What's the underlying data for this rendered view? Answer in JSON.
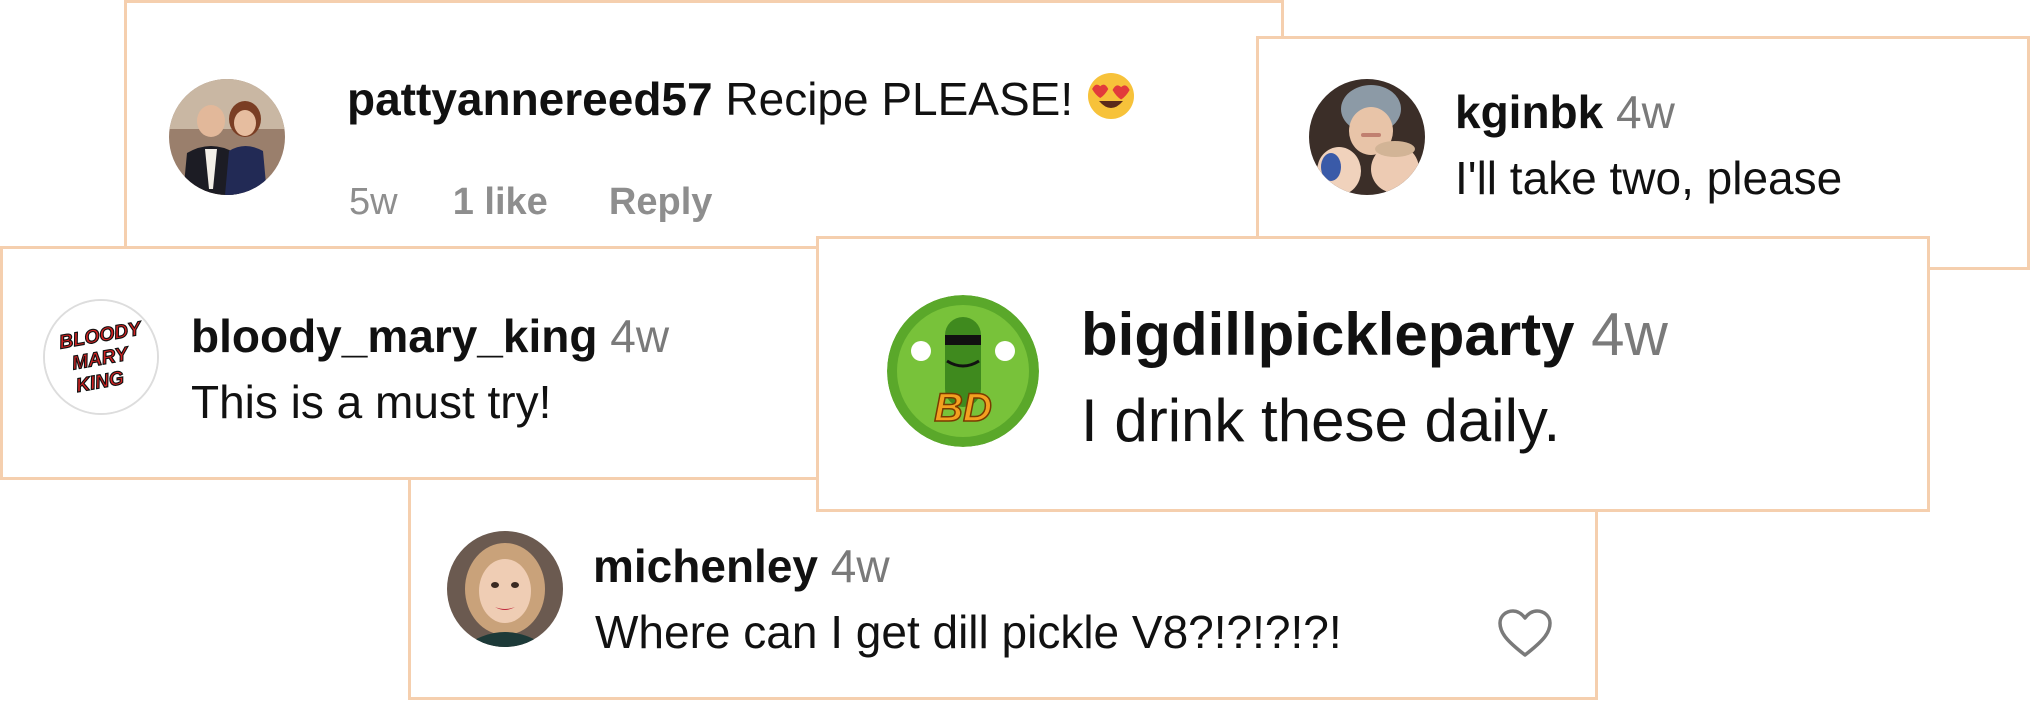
{
  "comments": [
    {
      "username": "pattyannereed57",
      "text": "Recipe PLEASE!",
      "emoji": "heart-eyes-emoji",
      "meta": {
        "time": "5w",
        "likes": "1 like",
        "reply": "Reply"
      },
      "avatar": "couple-photo-avatar"
    },
    {
      "username": "kginbk",
      "time": "4w",
      "text": "I'll take two, please",
      "avatar": "mother-and-children-avatar"
    },
    {
      "username": "bloody_mary_king",
      "time": "4w",
      "text": "This is a must try!",
      "avatar": "bloody-mary-king-logo-avatar",
      "logo_text": "BLOODY MARY KING"
    },
    {
      "username": "bigdillpickleparty",
      "time": "4w",
      "text": "I drink these daily.",
      "avatar": "pickle-mascot-avatar",
      "logo_text": "BD"
    },
    {
      "username": "michenley",
      "time": "4w",
      "text": "Where can I get dill pickle V8?!?!?!?!",
      "avatar": "woman-portrait-avatar",
      "like_icon": "heart-outline-icon"
    }
  ],
  "colors": {
    "card_border": "#f5cfae",
    "username": "#111111",
    "timestamp": "#7a7a7a",
    "meta": "#8e8e8e"
  }
}
